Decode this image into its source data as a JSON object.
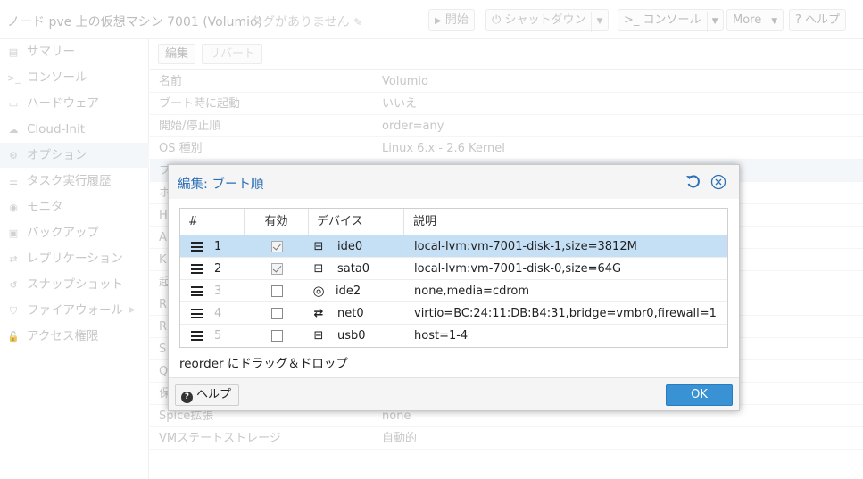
{
  "topbar": {
    "title": "ノード pve 上の仮想マシン 7001 (Volumio)",
    "tags": "タグがありません",
    "buttons": {
      "start": "開始",
      "shutdown": "シャットダウン",
      "console": "コンソール",
      "more": "More",
      "help": "ヘルプ"
    }
  },
  "sidebar": {
    "items": [
      {
        "label": "サマリー",
        "icon": "book-icon"
      },
      {
        "label": "コンソール",
        "icon": "terminal-icon"
      },
      {
        "label": "ハードウェア",
        "icon": "desktop-icon"
      },
      {
        "label": "Cloud-Init",
        "icon": "cloud-icon"
      },
      {
        "label": "オプション",
        "icon": "gear-icon"
      },
      {
        "label": "タスク実行履歴",
        "icon": "list-icon"
      },
      {
        "label": "モニタ",
        "icon": "eye-icon"
      },
      {
        "label": "バックアップ",
        "icon": "floppy-icon"
      },
      {
        "label": "レプリケーション",
        "icon": "retweet-icon"
      },
      {
        "label": "スナップショット",
        "icon": "history-icon"
      },
      {
        "label": "ファイアウォール",
        "icon": "shield-icon"
      },
      {
        "label": "アクセス権限",
        "icon": "unlock-icon"
      }
    ]
  },
  "options": {
    "toolbar": {
      "edit": "編集",
      "revert": "リバート"
    },
    "rows": [
      {
        "key": "名前",
        "value": "Volumio"
      },
      {
        "key": "ブート時に起動",
        "value": "いいえ"
      },
      {
        "key": "開始/停止順",
        "value": "order=any"
      },
      {
        "key": "OS 種別",
        "value": "Linux 6.x - 2.6 Kernel"
      },
      {
        "key": "ブ",
        "value": ""
      },
      {
        "key": "ホ",
        "value": ""
      },
      {
        "key": "H",
        "value": ""
      },
      {
        "key": "A",
        "value": ""
      },
      {
        "key": "K",
        "value": ""
      },
      {
        "key": "起",
        "value": ""
      },
      {
        "key": "R",
        "value": ""
      },
      {
        "key": "R",
        "value": ""
      },
      {
        "key": "S",
        "value": ""
      },
      {
        "key": "Q",
        "value": ""
      },
      {
        "key": "保",
        "value": ""
      },
      {
        "key": "Spice拡張",
        "value": "none"
      },
      {
        "key": "VMステートストレージ",
        "value": "自動的"
      }
    ]
  },
  "dialog": {
    "title": "編集: ブート順",
    "columns": {
      "num": "#",
      "enabled": "有効",
      "device": "デバイス",
      "desc": "説明"
    },
    "rows": [
      {
        "num": "1",
        "enabled": true,
        "device": "ide0",
        "icon": "hdd-icon",
        "desc": "local-lvm:vm-7001-disk-1,size=3812M"
      },
      {
        "num": "2",
        "enabled": true,
        "device": "sata0",
        "icon": "hdd-icon",
        "desc": "local-lvm:vm-7001-disk-0,size=64G"
      },
      {
        "num": "3",
        "enabled": false,
        "device": "ide2",
        "icon": "cdrom-icon",
        "desc": "none,media=cdrom"
      },
      {
        "num": "4",
        "enabled": false,
        "device": "net0",
        "icon": "exchange-icon",
        "desc": "virtio=BC:24:11:DB:B4:31,bridge=vmbr0,firewall=1"
      },
      {
        "num": "5",
        "enabled": false,
        "device": "usb0",
        "icon": "hdd-icon",
        "desc": "host=1-4"
      }
    ],
    "hint": "reorder にドラッグ＆ドロップ",
    "help": "ヘルプ",
    "ok": "OK"
  },
  "colors": {
    "accent": "#3892d4",
    "title": "#2a6eb5",
    "selected_row": "#c5dff5"
  }
}
